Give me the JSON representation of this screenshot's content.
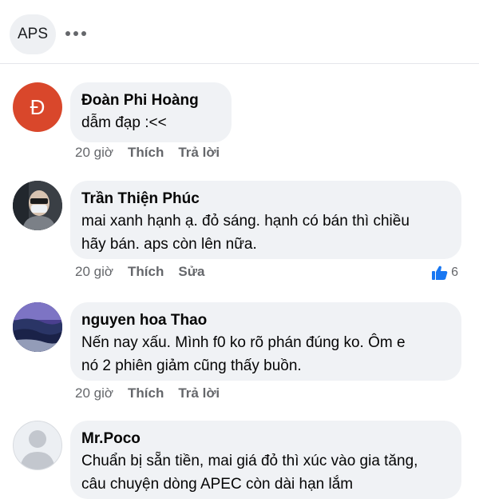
{
  "header": {
    "group_label": "APS"
  },
  "comments": [
    {
      "author": "Đoàn Phi Hoàng",
      "avatar_letter": "Đ",
      "text": "dẫm đạp :<<",
      "time": "20 giờ",
      "action1": "Thích",
      "action2": "Trả lời"
    },
    {
      "author": "Trần Thiện Phúc",
      "text": "mai xanh hạnh ạ. đỏ sáng. hạnh có bán thì chiều\nhãy bán. aps còn lên nữa.",
      "time": "20 giờ",
      "action1": "Thích",
      "action2": "Sửa",
      "reaction_count": "6",
      "reaction_icon": "thumbs-up-icon"
    },
    {
      "author": "nguyen hoa Thao",
      "text": "Nến nay xấu. Mình f0 ko rõ phán đúng ko. Ôm e\nnó 2 phiên giảm cũng thấy buồn.",
      "time": "20 giờ",
      "action1": "Thích",
      "action2": "Trả lời"
    },
    {
      "author": "Mr.Poco",
      "text": "Chuẩn bị sẵn tiền, mai giá đỏ thì xúc vào gia tăng,\ncâu chuyện dòng APEC còn dài hạn lắm",
      "time": "",
      "action1": "",
      "action2": ""
    }
  ],
  "colors": {
    "accent_red": "#d9472b",
    "like_blue": "#1877f2",
    "bubble_bg": "#f0f2f5",
    "meta_gray": "#65676b"
  }
}
